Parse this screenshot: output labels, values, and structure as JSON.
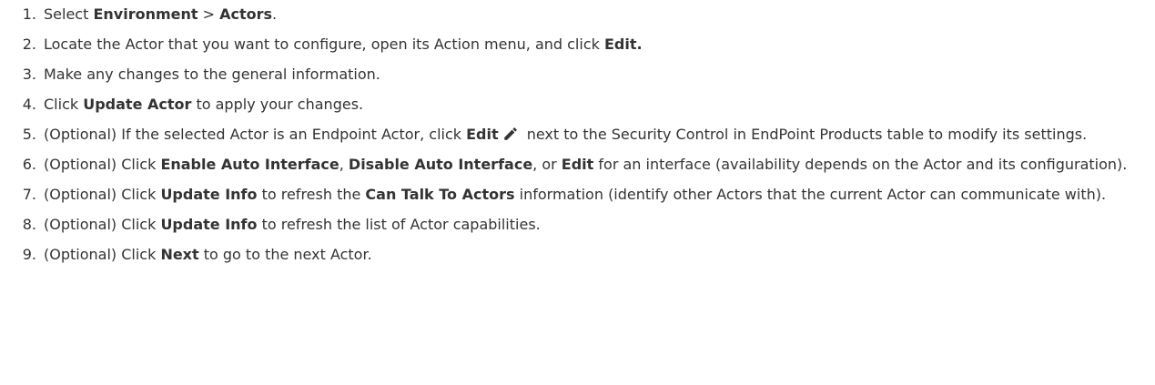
{
  "steps": [
    {
      "number": "1.",
      "t1": "Select ",
      "b1": "Environment",
      "t2": " > ",
      "b2": "Actors",
      "t3": "."
    },
    {
      "number": "2.",
      "t1": "Locate the Actor that you want to configure, open its Action menu, and click ",
      "b1": "Edit."
    },
    {
      "number": "3.",
      "t1": "Make any changes to the general information."
    },
    {
      "number": "4.",
      "t1": "Click ",
      "b1": "Update Actor",
      "t2": " to apply your changes."
    },
    {
      "number": "5.",
      "t1": "(Optional) If the selected Actor is an Endpoint Actor, click ",
      "b1": "Edit",
      "icon": "pencil-icon",
      "t2": " next to the Security Control in EndPoint Products table to modify its settings."
    },
    {
      "number": "6.",
      "t1": "(Optional) Click ",
      "b1": "Enable Auto Interface",
      "t2": ", ",
      "b2": "Disable Auto Interface",
      "t3": ", or ",
      "b3": "Edit",
      "t4": " for an interface (availability depends on the Actor and its configuration)."
    },
    {
      "number": "7.",
      "t1": "(Optional) Click ",
      "b1": "Update Info",
      "t2": " to refresh the ",
      "b2": "Can Talk To Actors",
      "t3": " information (identify other Actors that the current Actor can communicate with)."
    },
    {
      "number": "8.",
      "t1": "(Optional) Click ",
      "b1": "Update Info",
      "t2": " to refresh the list of Actor capabilities."
    },
    {
      "number": "9.",
      "t1": "(Optional) Click ",
      "b1": "Next",
      "t2": " to go to the next Actor."
    }
  ]
}
